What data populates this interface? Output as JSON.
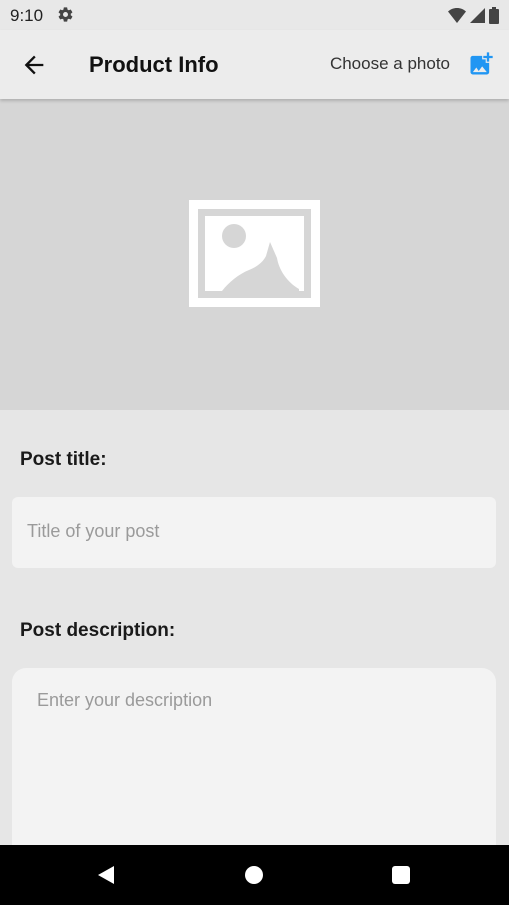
{
  "status_bar": {
    "time": "9:10"
  },
  "app_bar": {
    "title": "Product Info",
    "choose_photo_label": "Choose a photo"
  },
  "form": {
    "title_label": "Post title:",
    "title_placeholder": "Title of your post",
    "description_label": "Post description:",
    "description_placeholder": "Enter your description"
  },
  "icons": {
    "status_settings": "gear-icon",
    "status_wifi": "wifi-icon",
    "status_signal": "signal-icon",
    "status_battery": "battery-icon",
    "back": "arrow-left-icon",
    "add_photo": "add-photo-icon",
    "image_placeholder": "image-icon",
    "nav_back": "triangle-back-icon",
    "nav_home": "circle-home-icon",
    "nav_recents": "square-recents-icon"
  },
  "colors": {
    "accent": "#2196f3",
    "app_bar_bg": "#ececec",
    "image_area_bg": "#d6d6d6",
    "page_bg": "#e6e6e6",
    "input_bg": "#f3f3f3",
    "placeholder_text": "#9a9a9a",
    "nav_bar_bg": "#000000"
  }
}
